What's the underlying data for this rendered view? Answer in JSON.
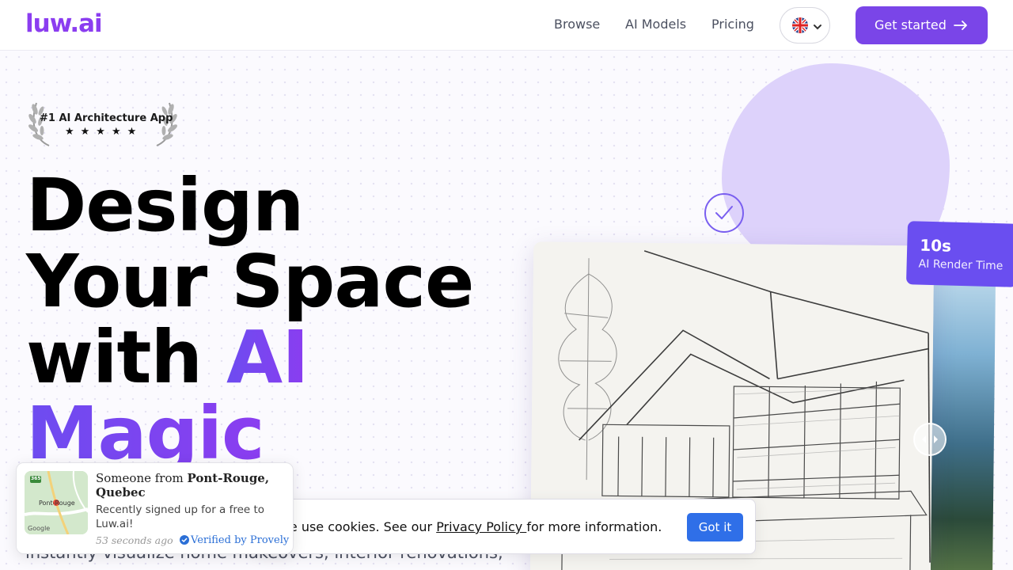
{
  "header": {
    "logo": "luw.ai",
    "nav": [
      "Browse",
      "AI Models",
      "Pricing"
    ],
    "language_icon": "uk-flag-icon",
    "cta_label": "Get started"
  },
  "award": {
    "title": "#1 AI Architecture App",
    "stars": "★★★★★",
    "rating": 5
  },
  "hero": {
    "line1": "Design",
    "line2": "Your Space",
    "line3_plain": "with ",
    "line3_accent": "AI",
    "line4": "Magic",
    "subtitle": "instantly visualize home makeovers, interior renovations,"
  },
  "showcase": {
    "stat_value": "10s",
    "stat_label": "AI Render Time"
  },
  "cookie": {
    "text_before": "We use cookies. See our ",
    "link": "Privacy Policy ",
    "text_after": "for more information.",
    "button": "Got it"
  },
  "toast": {
    "prefix": "Someone from ",
    "location": "Pont-Rouge, Quebec",
    "message": "Recently signed up for a free to Luw.ai!",
    "time": "53 seconds ago",
    "verified": "Verified by Provely",
    "map_label": "Pont-Rouge",
    "map_road": "365",
    "map_brand": "Google"
  },
  "colors": {
    "brand": "#8b3df0",
    "cta": "#7a45e8",
    "accent": "#6d4cf0",
    "blob": "#ddd2fb",
    "cookie_button": "#2f6fe8",
    "verified": "#2b6fd6"
  }
}
